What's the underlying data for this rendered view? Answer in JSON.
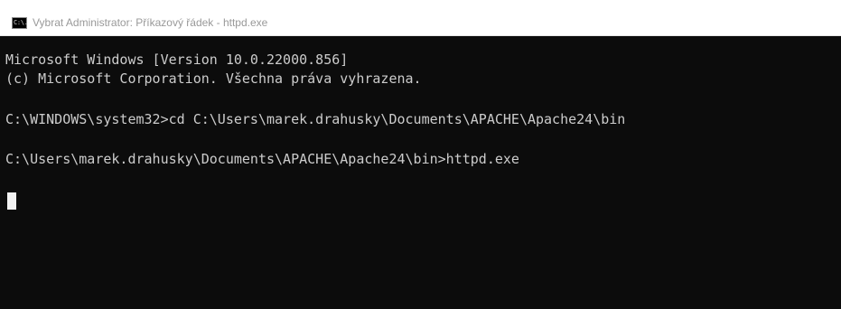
{
  "window": {
    "title": "Vybrat Administrator: Příkazový řádek - httpd.exe",
    "icon": "command-prompt-icon",
    "icon_text": "C:\\."
  },
  "console": {
    "lines": [
      "Microsoft Windows [Version 10.0.22000.856]",
      "(c) Microsoft Corporation. Všechna práva vyhrazena.",
      "C:\\WINDOWS\\system32>cd C:\\Users\\marek.drahusky\\Documents\\APACHE\\Apache24\\bin",
      "C:\\Users\\marek.drahusky\\Documents\\APACHE\\Apache24\\bin>httpd.exe"
    ]
  },
  "colors": {
    "title_background": "#ffffff",
    "title_text": "#999999",
    "console_background": "#0c0c0c",
    "console_text": "#cccccc",
    "cursor": "#f2f2f2"
  }
}
